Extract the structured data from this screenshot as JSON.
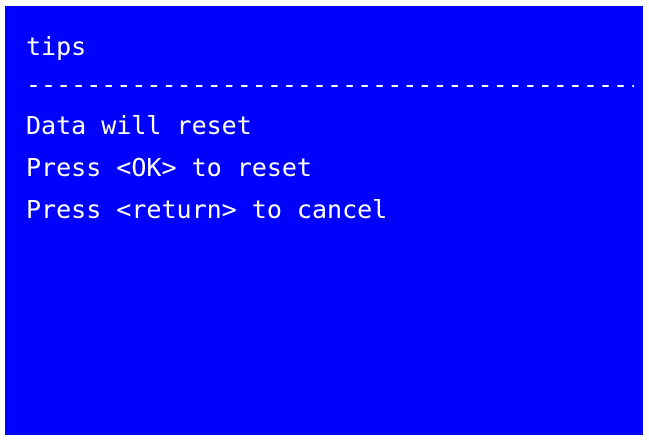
{
  "dialog": {
    "title": "tips",
    "divider": "-------------------------------------------",
    "lines": [
      "Data will reset",
      "Press <OK> to reset",
      "Press <return> to cancel"
    ]
  },
  "colors": {
    "background": "#0000ff",
    "text": "#ffffff"
  }
}
